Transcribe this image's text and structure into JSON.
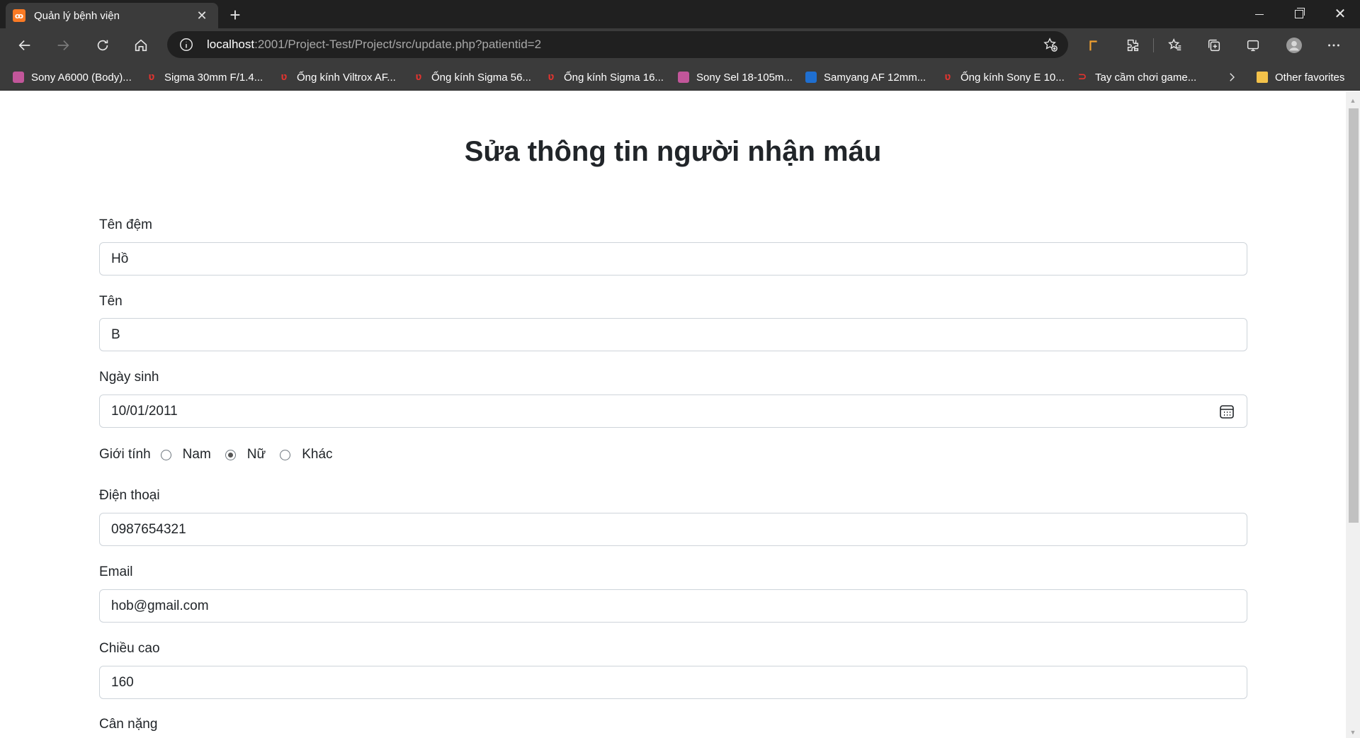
{
  "browser": {
    "tab_title": "Quản lý bệnh viện",
    "url_host": "localhost",
    "url_rest": ":2001/Project-Test/Project/src/update.php?patientid=2",
    "icons": {
      "favicon": "xampp-icon",
      "close": "close-icon",
      "new_tab": "plus-icon",
      "back": "arrow-left-icon",
      "forward": "arrow-right-icon",
      "refresh": "refresh-icon",
      "home": "home-icon",
      "info": "info-icon",
      "add_favorite": "star-plus-icon",
      "extensions": [
        "bookmark-extension-icon",
        "puzzle-icon",
        "favorites-icon",
        "collections-icon",
        "share-icon",
        "profile-icon",
        "more-icon"
      ]
    },
    "bookmarks": [
      {
        "label": "Sony A6000 (Body)...",
        "icon": "sony-icon"
      },
      {
        "label": "Sigma 30mm F/1.4...",
        "icon": "shop-icon"
      },
      {
        "label": "Ống kính Viltrox AF...",
        "icon": "shop-icon"
      },
      {
        "label": "Ống kính Sigma 56...",
        "icon": "shop-icon"
      },
      {
        "label": "Ống kính Sigma 16...",
        "icon": "shop-icon"
      },
      {
        "label": "Sony Sel 18-105m...",
        "icon": "sony-icon"
      },
      {
        "label": "Samyang AF 12mm...",
        "icon": "camera-shop-icon"
      },
      {
        "label": "Ống kính Sony E 10...",
        "icon": "shop-icon"
      },
      {
        "label": "Tay cầm chơi game...",
        "icon": "gamepad-icon"
      }
    ],
    "other_favorites": "Other favorites"
  },
  "form": {
    "title": "Sửa thông tin người nhận máu",
    "middle_name": {
      "label": "Tên đệm",
      "value": "Hồ"
    },
    "first_name": {
      "label": "Tên",
      "value": "B"
    },
    "dob": {
      "label": "Ngày sinh",
      "value": "10/01/2011"
    },
    "gender": {
      "label": "Giới tính",
      "options": [
        "Nam",
        "Nữ",
        "Khác"
      ],
      "selected": "Nữ"
    },
    "phone": {
      "label": "Điện thoại",
      "value": "0987654321"
    },
    "email": {
      "label": "Email",
      "value": "hob@gmail.com"
    },
    "height": {
      "label": "Chiều cao",
      "value": "160"
    },
    "weight": {
      "label": "Cân nặng"
    }
  }
}
